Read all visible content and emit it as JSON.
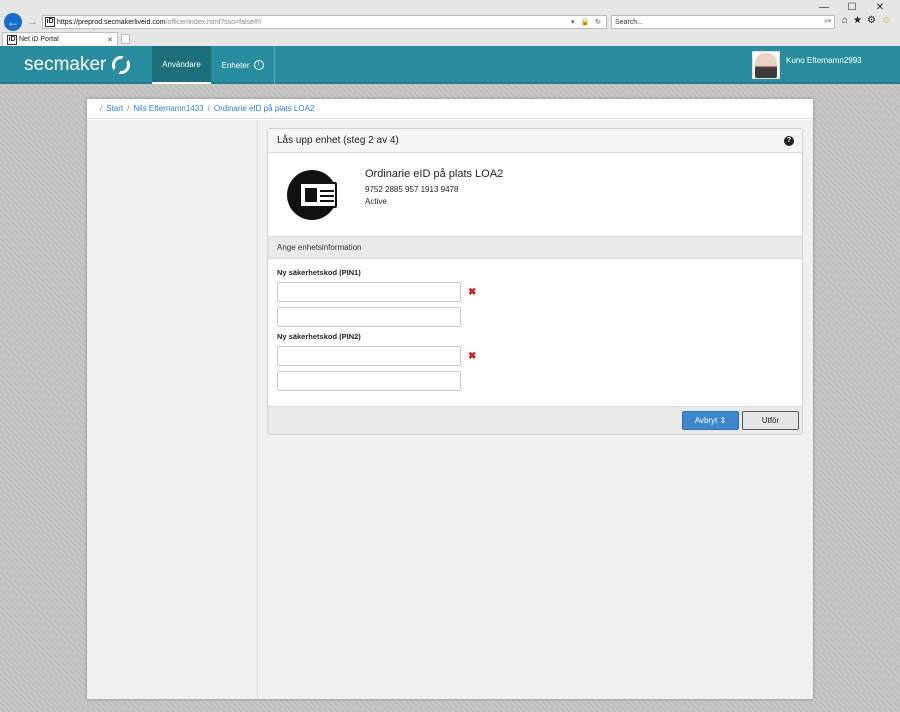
{
  "browser": {
    "window_buttons": [
      "—",
      "☐",
      "✕"
    ],
    "url_main": "https://preprod.secmakerliveid.com",
    "url_rest": "/officer/index.html?sso=false#!/",
    "search_placeholder": "Search...",
    "tab_title": "Net iD Portal"
  },
  "header": {
    "logo_text": "secmaker",
    "nav": {
      "users_label": "Användare",
      "devices_label": "Enheter",
      "devices_badge": "!"
    },
    "user_name": "Kuno Efternamn2993"
  },
  "breadcrumb": {
    "items": [
      "Start",
      "Nils Efternamn1433",
      "Ordinarie eID på plats LOA2"
    ]
  },
  "card": {
    "title": "Lås upp enhet (steg 2 av 4)",
    "help_glyph": "?",
    "device": {
      "name": "Ordinarie eID på plats LOA2",
      "serial": "9752 2885 957 1913 9478",
      "status": "Active"
    },
    "section_title": "Ange enhetsinformation",
    "pin1_label": "Ny säkerhetskod (PIN1)",
    "pin2_label": "Ny säkerhetskod (PIN2)",
    "pin1_value": "",
    "pin1_confirm_value": "",
    "pin2_value": "",
    "pin2_confirm_value": "",
    "error_glyph": "✖",
    "cancel_label": "Avbryt",
    "execute_label": "Utför"
  },
  "colors": {
    "brand": "#2a8d9f",
    "link": "#2a7fc7",
    "primary_button": "#3d87cd",
    "error": "#d01f1f"
  }
}
